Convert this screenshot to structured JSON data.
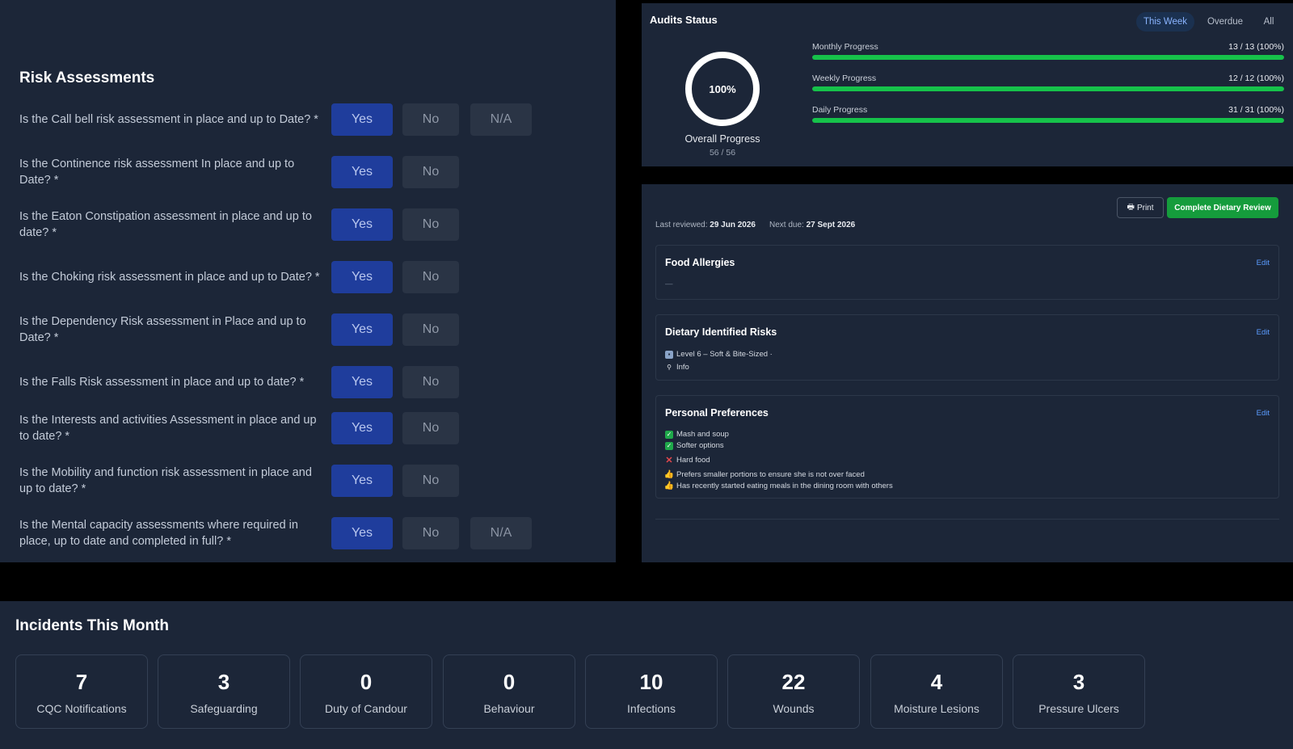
{
  "risk": {
    "title": "Risk Assessments",
    "questions": [
      {
        "text": "Is the Call bell risk assessment in place and up to Date? *",
        "options": [
          "Yes",
          "No",
          "N/A"
        ],
        "selected": "Yes"
      },
      {
        "text": "Is the Continence risk assessment In place and up to Date? *",
        "options": [
          "Yes",
          "No"
        ],
        "selected": "Yes"
      },
      {
        "text": "Is the Eaton Constipation assessment in place and up to date? *",
        "options": [
          "Yes",
          "No"
        ],
        "selected": "Yes"
      },
      {
        "text": "Is the Choking risk assessment in place and up to Date? *",
        "options": [
          "Yes",
          "No"
        ],
        "selected": "Yes"
      },
      {
        "text": "Is the Dependency Risk assessment in Place and up to Date? *",
        "options": [
          "Yes",
          "No"
        ],
        "selected": "Yes"
      },
      {
        "text": "Is the Falls Risk assessment in place and up to date? *",
        "options": [
          "Yes",
          "No"
        ],
        "selected": "Yes"
      },
      {
        "text": "Is the Interests and activities Assessment in place and up to date? *",
        "options": [
          "Yes",
          "No"
        ],
        "selected": "Yes"
      },
      {
        "text": "Is the Mobility and function risk assessment in place and up to date? *",
        "options": [
          "Yes",
          "No"
        ],
        "selected": "Yes"
      },
      {
        "text": "Is the Mental capacity assessments where required in place, up to date and completed in full? *",
        "options": [
          "Yes",
          "No",
          "N/A"
        ],
        "selected": "Yes"
      }
    ]
  },
  "audits": {
    "title": "Audits Status",
    "tabs": [
      "This Week",
      "Overdue",
      "All"
    ],
    "active_tab": "This Week",
    "overall": {
      "percent": "100%",
      "label": "Overall Progress",
      "count": "56 / 56"
    },
    "progress": [
      {
        "label": "Monthly Progress",
        "value": "13 / 13 (100%)",
        "fraction": 1.0
      },
      {
        "label": "Weekly Progress",
        "value": "12 / 12 (100%)",
        "fraction": 1.0
      },
      {
        "label": "Daily Progress",
        "value": "31 / 31 (100%)",
        "fraction": 1.0
      }
    ],
    "colors": {
      "bar_fill": "#16c24a",
      "active_tab": "#8ab4ff"
    }
  },
  "diet": {
    "print_label": "Print",
    "complete_label": "Complete Dietary Review",
    "last_reviewed_label": "Last reviewed:",
    "last_reviewed": "29 Jun 2026",
    "next_due_label": "Next due:",
    "next_due": "27 Sept 2026",
    "edit_label": "Edit",
    "allergies": {
      "title": "Food Allergies",
      "value": "—"
    },
    "risks": {
      "title": "Dietary Identified Risks",
      "items": [
        {
          "icon": "level-icon",
          "text": "Level 6 – Soft & Bite-Sized ·"
        },
        {
          "icon": "pin-icon",
          "text": "Info"
        }
      ]
    },
    "preferences": {
      "title": "Personal Preferences",
      "items": [
        {
          "icon": "check-icon",
          "text": "Mash and soup"
        },
        {
          "icon": "check-icon",
          "text": "Softer options"
        },
        {
          "icon": "cross-icon",
          "text": "Hard food"
        },
        {
          "icon": "thumbs-up-icon",
          "text": "Prefers smaller portions to ensure she is not over faced"
        },
        {
          "icon": "thumbs-up-icon",
          "text": "Has recently started eating meals in the dining room with others"
        }
      ]
    }
  },
  "incidents": {
    "title": "Incidents This Month",
    "items": [
      {
        "value": "7",
        "label": "CQC Notifications"
      },
      {
        "value": "3",
        "label": "Safeguarding"
      },
      {
        "value": "0",
        "label": "Duty of Candour"
      },
      {
        "value": "0",
        "label": "Behaviour"
      },
      {
        "value": "10",
        "label": "Infections"
      },
      {
        "value": "22",
        "label": "Wounds"
      },
      {
        "value": "4",
        "label": "Moisture Lesions"
      },
      {
        "value": "3",
        "label": "Pressure Ulcers"
      }
    ]
  }
}
